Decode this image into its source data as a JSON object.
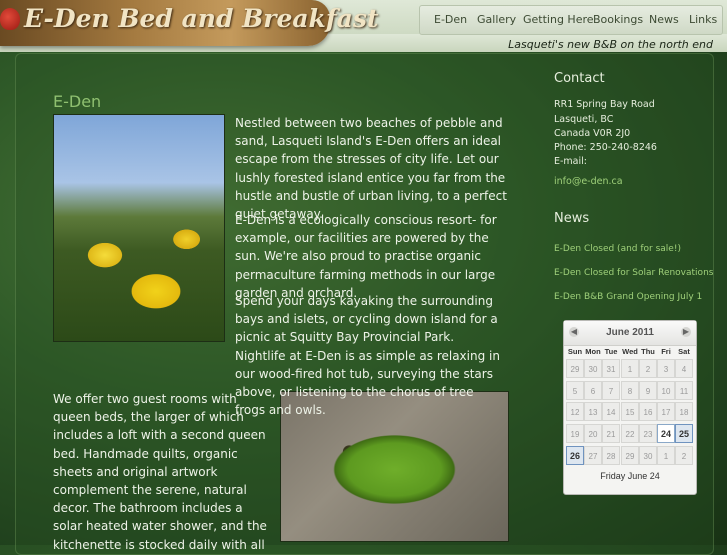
{
  "site": {
    "logo_text": "E-Den Bed and Breakfast",
    "tagline": "Lasqueti's new B&B on the north end"
  },
  "nav": [
    "E-Den",
    "Gallery",
    "Getting Here",
    "Bookings",
    "News",
    "Links"
  ],
  "main": {
    "title": "E-Den",
    "paragraphs": [
      "Nestled between two beaches of pebble and sand, Lasqueti Island's E-Den offers an ideal escape from the stresses of city life. Let our lushly forested island entice you far from the hustle and bustle of urban living, to a perfect quiet getaway.",
      "E-Den is a ecologically conscious resort- for example, our facilities are powered by the sun. We're also proud to practise organic permaculture farming methods in our large garden and orchard.",
      "Spend your days kayaking the surrounding bays and islets, or cycling down island for a picnic at Squitty Bay Provincial Park. Nightlife at E-Den is as simple as relaxing in our wood-fired hot tub, surveying the stars above, or listening to the chorus of tree frogs and owls.",
      "We offer two guest rooms with queen beds, the larger of which includes a loft with a second queen bed. Handmade quilts, organic sheets and original artwork complement the serene, natural decor. The bathroom includes a solar heated water shower, and the kitchenette is stocked daily with all organic brands, cereals, eggs, coffee"
    ]
  },
  "contact": {
    "heading": "Contact",
    "lines": [
      "RR1 Spring Bay Road",
      "Lasqueti, BC",
      "Canada V0R 2J0",
      "Phone: 250-240-8246",
      "E-mail:"
    ],
    "email": "info@e-den.ca"
  },
  "news": {
    "heading": "News",
    "items": [
      "E-Den Closed (and for sale!)",
      "E-Den Closed for Solar Renovations",
      "E-Den B&B Grand Opening July 1"
    ]
  },
  "calendar": {
    "month": "June 2011",
    "days_of_week": [
      "Sun",
      "Mon",
      "Tue",
      "Wed",
      "Thu",
      "Fri",
      "Sat"
    ],
    "weeks": [
      [
        "29",
        "30",
        "31",
        "1",
        "2",
        "3",
        "4"
      ],
      [
        "5",
        "6",
        "7",
        "8",
        "9",
        "10",
        "11"
      ],
      [
        "12",
        "13",
        "14",
        "15",
        "16",
        "17",
        "18"
      ],
      [
        "19",
        "20",
        "21",
        "22",
        "23",
        "24",
        "25"
      ],
      [
        "26",
        "27",
        "28",
        "29",
        "30",
        "1",
        "2"
      ]
    ],
    "today": "24",
    "selected": "25",
    "footer": "Friday June 24"
  }
}
